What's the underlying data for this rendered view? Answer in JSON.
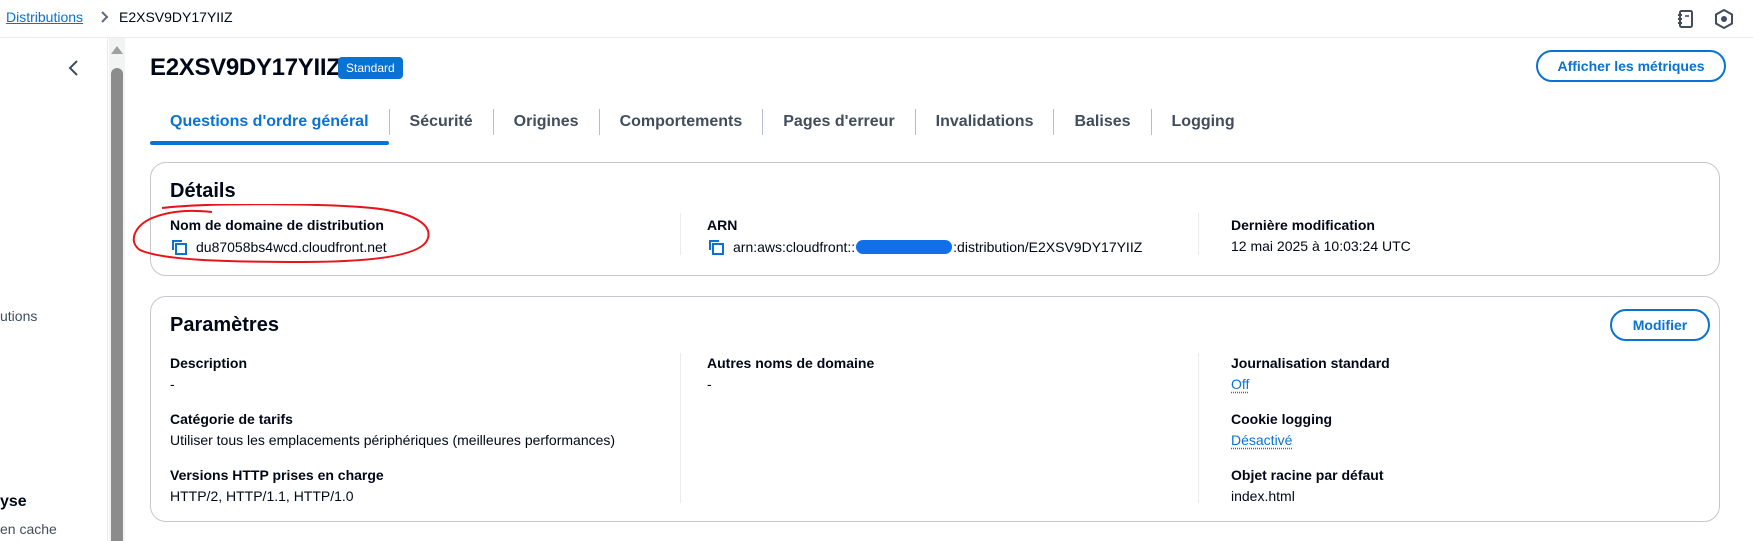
{
  "breadcrumb": {
    "parent": "Distributions",
    "current": "E2XSV9DY17YIIZ"
  },
  "topbar_icons": [
    "notebook-icon",
    "settings-hex-icon"
  ],
  "leftnav": {
    "fragments": [
      "utions",
      "yse",
      "en cache"
    ]
  },
  "header": {
    "title": "E2XSV9DY17YIIZ",
    "badge": "Standard",
    "metrics_button": "Afficher les métriques"
  },
  "tabs": [
    {
      "label": "Questions d'ordre général",
      "active": true
    },
    {
      "label": "Sécurité",
      "active": false
    },
    {
      "label": "Origines",
      "active": false
    },
    {
      "label": "Comportements",
      "active": false
    },
    {
      "label": "Pages d'erreur",
      "active": false
    },
    {
      "label": "Invalidations",
      "active": false
    },
    {
      "label": "Balises",
      "active": false
    },
    {
      "label": "Logging",
      "active": false
    }
  ],
  "details": {
    "title": "Détails",
    "domain_label": "Nom de domaine de distribution",
    "domain_value": "du87058bs4wcd.cloudfront.net",
    "arn_label": "ARN",
    "arn_prefix": "arn:aws:cloudfront::",
    "arn_suffix": ":distribution/E2XSV9DY17YIIZ",
    "modified_label": "Dernière modification",
    "modified_value": "12 mai 2025 à 10:03:24 UTC"
  },
  "parametres": {
    "title": "Paramètres",
    "edit_button": "Modifier",
    "description_label": "Description",
    "description_value": "-",
    "price_label": "Catégorie de tarifs",
    "price_value": "Utiliser tous les emplacements périphériques (meilleures performances)",
    "http_label": "Versions HTTP prises en charge",
    "http_value": "HTTP/2, HTTP/1.1, HTTP/1.0",
    "alt_names_label": "Autres noms de domaine",
    "alt_names_value": "-",
    "std_logging_label": "Journalisation standard",
    "std_logging_value": "Off",
    "cookie_label": "Cookie logging",
    "cookie_value": "Désactivé",
    "root_label": "Objet racine par défaut",
    "root_value": "index.html"
  },
  "colors": {
    "accent": "#0972d3",
    "annotation": "#e8141c",
    "redaction": "#1170e8"
  }
}
